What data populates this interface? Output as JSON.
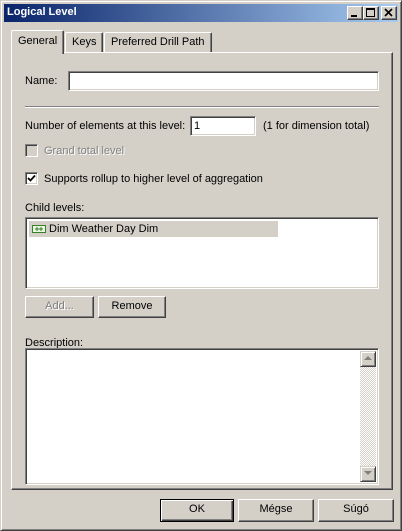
{
  "window": {
    "title": "Logical Level"
  },
  "tabs": [
    {
      "label": "General",
      "active": true
    },
    {
      "label": "Keys",
      "active": false
    },
    {
      "label": "Preferred Drill Path",
      "active": false
    }
  ],
  "form": {
    "name_label": "Name:",
    "name_value": "",
    "elements_label": "Number of elements at this level:",
    "elements_value": "1",
    "elements_hint": "(1 for dimension total)",
    "grand_total_label": "Grand total level",
    "grand_total_checked": false,
    "rollup_label": "Supports rollup to higher level of aggregation",
    "rollup_checked": true,
    "child_levels_label": "Child levels:",
    "child_levels": [
      "Dim Weather Day Dim"
    ],
    "add_label": "Add...",
    "remove_label": "Remove",
    "description_label": "Description:",
    "description_value": ""
  },
  "footer": {
    "ok_label": "OK",
    "cancel_label": "Mégse",
    "help_label": "Súgó"
  },
  "colors": {
    "title_start": "#0a246a",
    "title_end": "#a6caf0",
    "face": "#d4d0c8"
  },
  "icons": {
    "minimize": "minimize-icon",
    "maximize": "maximize-icon",
    "close": "close-icon",
    "level": "level-icon",
    "check": "check-icon",
    "scroll_up": "arrow-up-icon",
    "scroll_down": "arrow-down-icon"
  }
}
